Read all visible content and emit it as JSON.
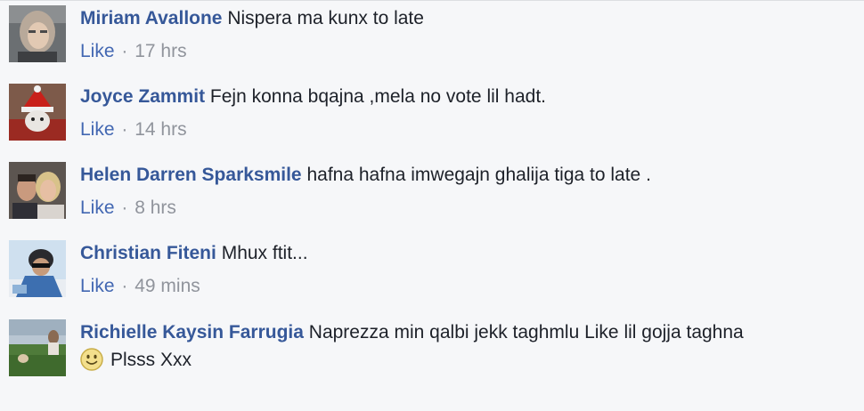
{
  "comments": [
    {
      "author": "Miriam Avallone",
      "text": "Nispera ma kunx to late",
      "like_label": "Like",
      "separator": "·",
      "time": "17 hrs"
    },
    {
      "author": "Joyce Zammit",
      "text": "Fejn konna bqajna ,mela no vote lil hadt.",
      "like_label": "Like",
      "separator": "·",
      "time": "14 hrs"
    },
    {
      "author": "Helen Darren Sparksmile",
      "text": "hafna hafna imwegajn ghalija tiga to late .",
      "like_label": "Like",
      "separator": "·",
      "time": "8 hrs"
    },
    {
      "author": "Christian Fiteni",
      "text": "Mhux ftit...",
      "like_label": "Like",
      "separator": "·",
      "time": "49 mins"
    },
    {
      "author": "Richielle Kaysin Farrugia",
      "text": "Naprezza min qalbi jekk taghmlu Like lil gojja taghna",
      "text_line2": "Plsss Xxx",
      "emoji": "smiley-icon"
    }
  ],
  "colors": {
    "author": "#365899",
    "like": "#4267b2",
    "meta": "#90949c",
    "text": "#1d2129",
    "background": "#f6f7f9"
  }
}
